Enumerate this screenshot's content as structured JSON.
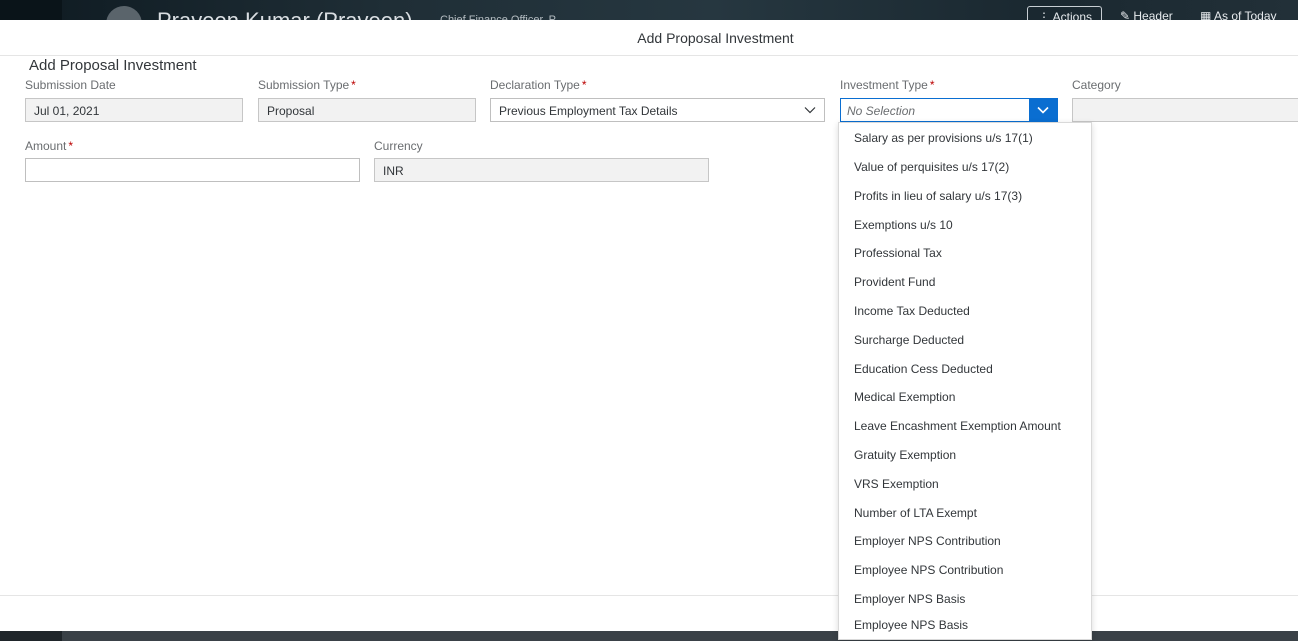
{
  "background": {
    "user_name": "Praveen Kumar (Praveen)",
    "subtitle": "Chief Finance Officer, P",
    "actions_label": "Actions",
    "header_label": "Header",
    "as_of_label": "As of Today"
  },
  "dialog": {
    "title": "Add Proposal Investment",
    "section_title": "Add Proposal Investment"
  },
  "fields": {
    "submission_date": {
      "label": "Submission Date",
      "value": "Jul 01, 2021"
    },
    "submission_type": {
      "label": "Submission Type",
      "required": "*",
      "value": "Proposal"
    },
    "declaration_type": {
      "label": "Declaration Type",
      "required": "*",
      "value": "Previous Employment Tax Details"
    },
    "investment_type": {
      "label": "Investment Type",
      "required": "*",
      "placeholder": "No Selection"
    },
    "category": {
      "label": "Category",
      "value": ""
    },
    "amount": {
      "label": "Amount",
      "required": "*",
      "value": ""
    },
    "currency": {
      "label": "Currency",
      "value": "INR"
    }
  },
  "dropdown": {
    "items": [
      "Salary as per provisions u/s 17(1)",
      "Value of perquisites u/s 17(2)",
      "Profits in lieu of salary u/s 17(3)",
      "Exemptions u/s 10",
      "Professional Tax",
      "Provident Fund",
      "Income Tax Deducted",
      "Surcharge Deducted",
      "Education Cess Deducted",
      "Medical Exemption",
      "Leave Encashment Exemption Amount",
      "Gratuity Exemption",
      "VRS Exemption",
      "Number of LTA Exempt",
      "Employer NPS Contribution",
      "Employee NPS Contribution",
      "Employer NPS Basis",
      "Employee NPS Basis"
    ]
  },
  "colors": {
    "accent": "#0a6ed1",
    "required": "#bb0000",
    "label": "#6a6d70",
    "text": "#32363a"
  }
}
